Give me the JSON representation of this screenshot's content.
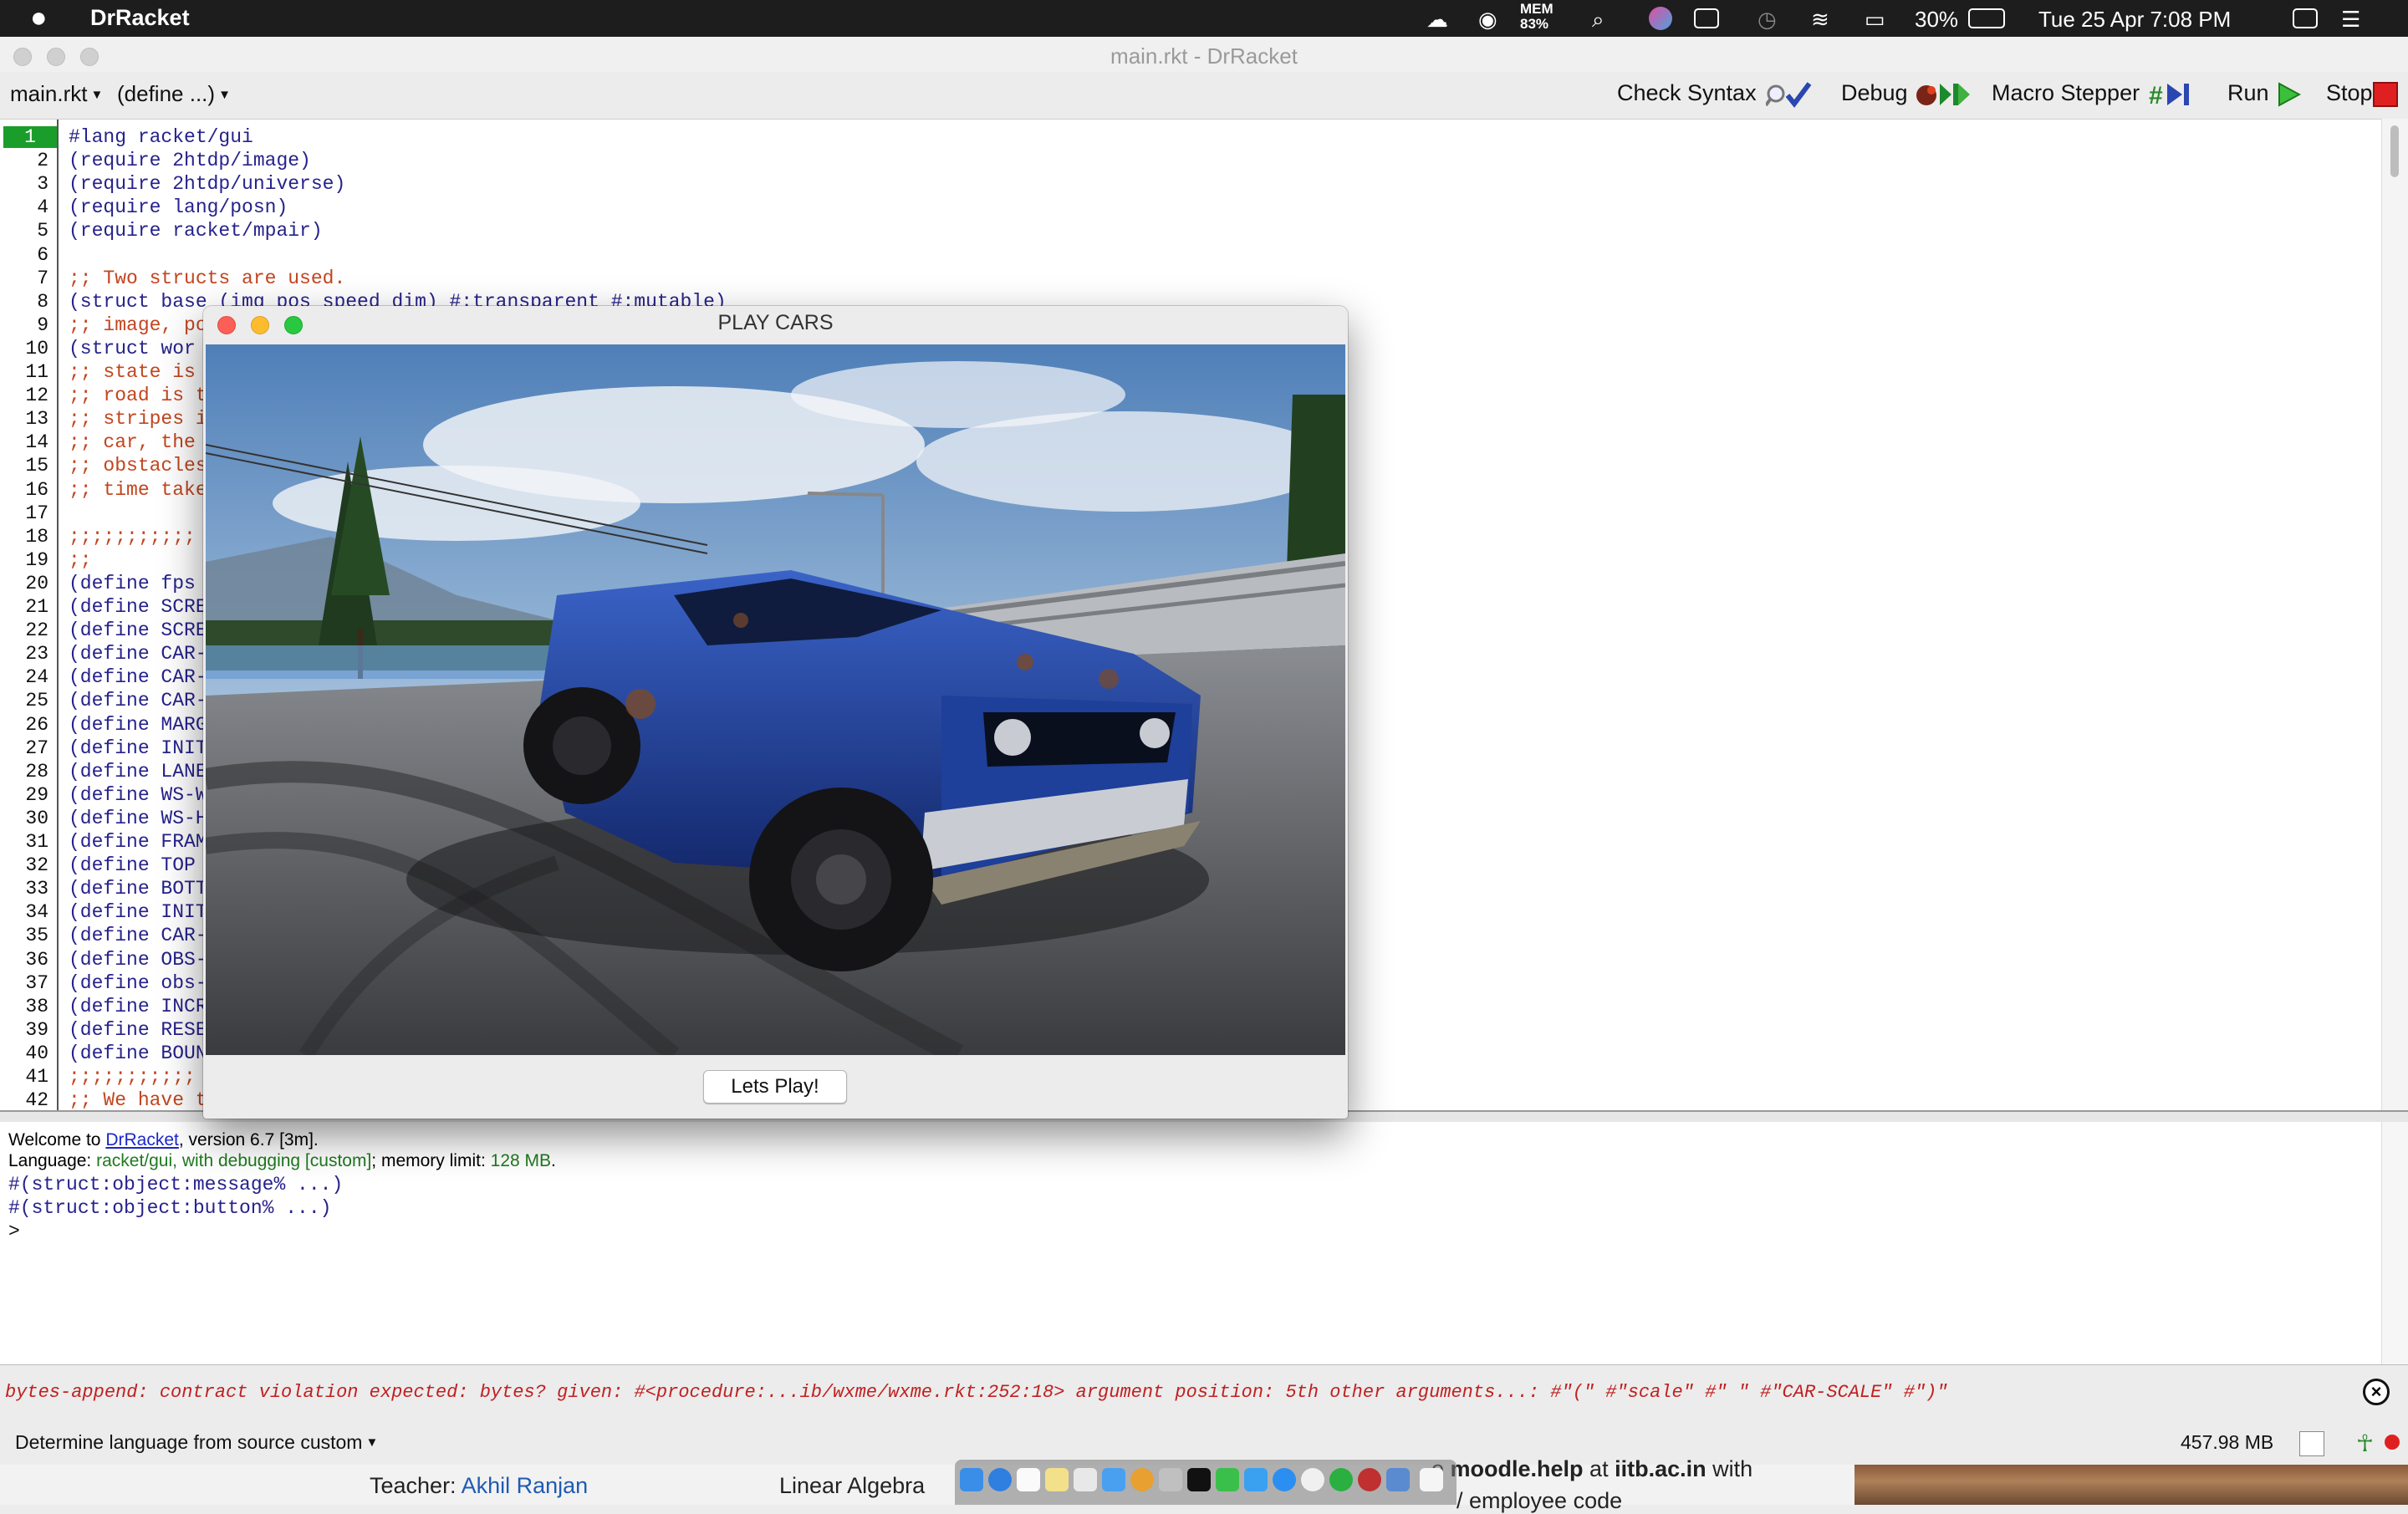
{
  "menubar": {
    "app_name": "DrRacket",
    "mem_label": "MEM",
    "mem_value": "83%",
    "battery": "30%",
    "clock": "Tue 25 Apr  7:08 PM"
  },
  "window": {
    "title": "main.rkt - DrRacket"
  },
  "toolbar": {
    "file_menu": "main.rkt",
    "define_menu": "(define ...)",
    "check_syntax": "Check Syntax",
    "debug": "Debug",
    "macro_stepper": "Macro Stepper",
    "run": "Run",
    "stop": "Stop"
  },
  "editor": {
    "lines": [
      {
        "n": "1",
        "text": "#lang racket/gui",
        "kind": "code"
      },
      {
        "n": "2",
        "text": "(require 2htdp/image)",
        "kind": "code"
      },
      {
        "n": "3",
        "text": "(require 2htdp/universe)",
        "kind": "code"
      },
      {
        "n": "4",
        "text": "(require lang/posn)",
        "kind": "code"
      },
      {
        "n": "5",
        "text": "(require racket/mpair)",
        "kind": "code"
      },
      {
        "n": "6",
        "text": "",
        "kind": "code"
      },
      {
        "n": "7",
        "text": ";; Two structs are used.",
        "kind": "cmt"
      },
      {
        "n": "8",
        "text": "(struct base (img pos speed dim) #:transparent #:mutable)",
        "kind": "code"
      },
      {
        "n": "9",
        "text": ";; image, po",
        "kind": "cmt"
      },
      {
        "n": "10",
        "text": "(struct wor",
        "kind": "code"
      },
      {
        "n": "11",
        "text": ";; state is",
        "kind": "cmt"
      },
      {
        "n": "12",
        "text": ";; road is t",
        "kind": "cmt"
      },
      {
        "n": "13",
        "text": ";; stripes i",
        "kind": "cmt"
      },
      {
        "n": "14",
        "text": ";; car, the",
        "kind": "cmt"
      },
      {
        "n": "15",
        "text": ";; obstacles",
        "kind": "cmt"
      },
      {
        "n": "16",
        "text": ";; time take",
        "kind": "cmt"
      },
      {
        "n": "17",
        "text": "",
        "kind": "code"
      },
      {
        "n": "18",
        "text": ";;;;;;;;;;;",
        "kind": "cmt"
      },
      {
        "n": "19",
        "text": ";;",
        "kind": "cmt"
      },
      {
        "n": "20",
        "text": "(define fps",
        "kind": "code"
      },
      {
        "n": "21",
        "text": "(define SCRE",
        "kind": "code"
      },
      {
        "n": "22",
        "text": "(define SCRE",
        "kind": "code"
      },
      {
        "n": "23",
        "text": "(define CAR-",
        "kind": "code"
      },
      {
        "n": "24",
        "text": "(define CAR-",
        "kind": "code"
      },
      {
        "n": "25",
        "text": "(define CAR-",
        "kind": "code"
      },
      {
        "n": "26",
        "text": "(define MARG",
        "kind": "code"
      },
      {
        "n": "27",
        "text": "(define INIT",
        "kind": "code"
      },
      {
        "n": "28",
        "text": "(define LANE",
        "kind": "code"
      },
      {
        "n": "29",
        "text": "(define WS-W",
        "kind": "code"
      },
      {
        "n": "30",
        "text": "(define WS-H",
        "kind": "code"
      },
      {
        "n": "31",
        "text": "(define FRAM",
        "kind": "code"
      },
      {
        "n": "32",
        "text": "(define TOP",
        "kind": "code"
      },
      {
        "n": "33",
        "text": "(define BOTT",
        "kind": "code"
      },
      {
        "n": "34",
        "text": "(define INIT",
        "kind": "code"
      },
      {
        "n": "35",
        "text": "(define CAR-",
        "kind": "code"
      },
      {
        "n": "36",
        "text": "(define OBS-",
        "kind": "code"
      },
      {
        "n": "37",
        "text": "(define obs-",
        "kind": "code"
      },
      {
        "n": "38",
        "text": "(define INCR",
        "kind": "code"
      },
      {
        "n": "39",
        "text": "(define RESE",
        "kind": "code"
      },
      {
        "n": "40",
        "text": "(define BOUN",
        "kind": "code"
      },
      {
        "n": "41",
        "text": ";;;;;;;;;;;",
        "kind": "cmt"
      },
      {
        "n": "42",
        "text": ";; We have t",
        "kind": "cmt"
      }
    ]
  },
  "repl": {
    "welcome_prefix": "Welcome to ",
    "welcome_link": "DrRacket",
    "welcome_suffix": ", version 6.7 [3m].",
    "lang_prefix": "Language: ",
    "lang_name": "racket/gui, with debugging [custom]",
    "lang_mid": "; memory limit: ",
    "lang_limit": "128 MB",
    "lang_end": ".",
    "out1": "#(struct:object:message% ...)",
    "out2": "#(struct:object:button% ...)",
    "prompt": ">"
  },
  "error": {
    "message": "bytes-append: contract violation expected: bytes? given: #<procedure:...ib/wxme/wxme.rkt:252:18> argument position: 5th other arguments...: #\"(\" #\"scale\" #\" \" #\"CAR-SCALE\" #\")\""
  },
  "status": {
    "language": "Determine language from source custom",
    "memory": "457.98 MB"
  },
  "background": {
    "teacher_label": "Teacher:",
    "teacher_name": "Akhil Ranjan",
    "course": "Linear Algebra",
    "moodle_prefix": "o ",
    "moodle_bold": "moodle.help",
    "moodle_mid": " at ",
    "moodle_domain": "iitb.ac.in",
    "moodle_end": " with",
    "employee": "/ employee code"
  },
  "dialog": {
    "title": "PLAY CARS",
    "button": "Lets Play!"
  },
  "colors": {
    "accent_green": "#1a9d2a",
    "code_blue": "#26228b",
    "comment_orange": "#c2451f",
    "error_red": "#c02020",
    "car_blue": "#1e3f9a"
  }
}
